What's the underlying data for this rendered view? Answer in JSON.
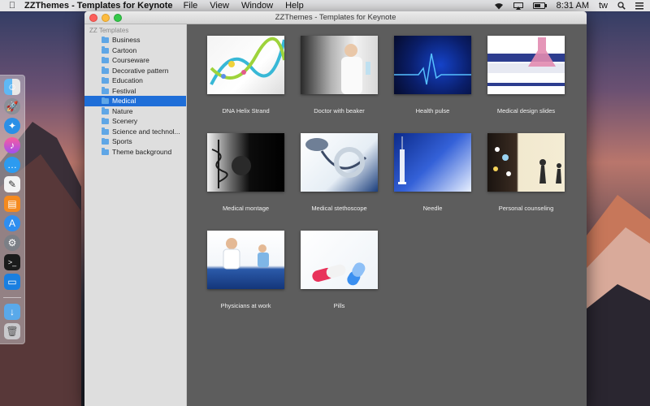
{
  "menubar": {
    "app_name": "ZZThemes - Templates for Keynote",
    "menus": [
      "File",
      "View",
      "Window",
      "Help"
    ],
    "time": "8:31 AM",
    "user": "tw"
  },
  "window": {
    "title": "ZZThemes - Templates for Keynote"
  },
  "sidebar": {
    "header": "ZZ Templates",
    "items": [
      {
        "label": "Business"
      },
      {
        "label": "Cartoon"
      },
      {
        "label": "Courseware"
      },
      {
        "label": "Decorative pattern"
      },
      {
        "label": "Education"
      },
      {
        "label": "Festival"
      },
      {
        "label": "Medical"
      },
      {
        "label": "Nature"
      },
      {
        "label": "Scenery"
      },
      {
        "label": "Science and technol..."
      },
      {
        "label": "Sports"
      },
      {
        "label": "Theme background"
      }
    ],
    "selected": "Medical"
  },
  "templates": [
    {
      "label": "DNA Helix Strand"
    },
    {
      "label": "Doctor with beaker"
    },
    {
      "label": "Health pulse"
    },
    {
      "label": "Medical design slides"
    },
    {
      "label": "Medical montage"
    },
    {
      "label": "Medical stethoscope"
    },
    {
      "label": "Needle"
    },
    {
      "label": "Personal counseling"
    },
    {
      "label": "Physicians at work"
    },
    {
      "label": "Pills"
    }
  ],
  "dock_icons": [
    "finder-icon",
    "launchpad-icon",
    "safari-icon",
    "itunes-icon",
    "messages-icon",
    "textedit-icon",
    "ibooks-icon",
    "app-store-icon",
    "system-preferences-icon",
    "terminal-icon",
    "keynote-icon",
    "downloads-folder-icon",
    "trash-icon"
  ],
  "colors": {
    "selection": "#1e6ed8",
    "content_bg": "#5d5d5d",
    "sidebar_bg": "#dedede"
  }
}
